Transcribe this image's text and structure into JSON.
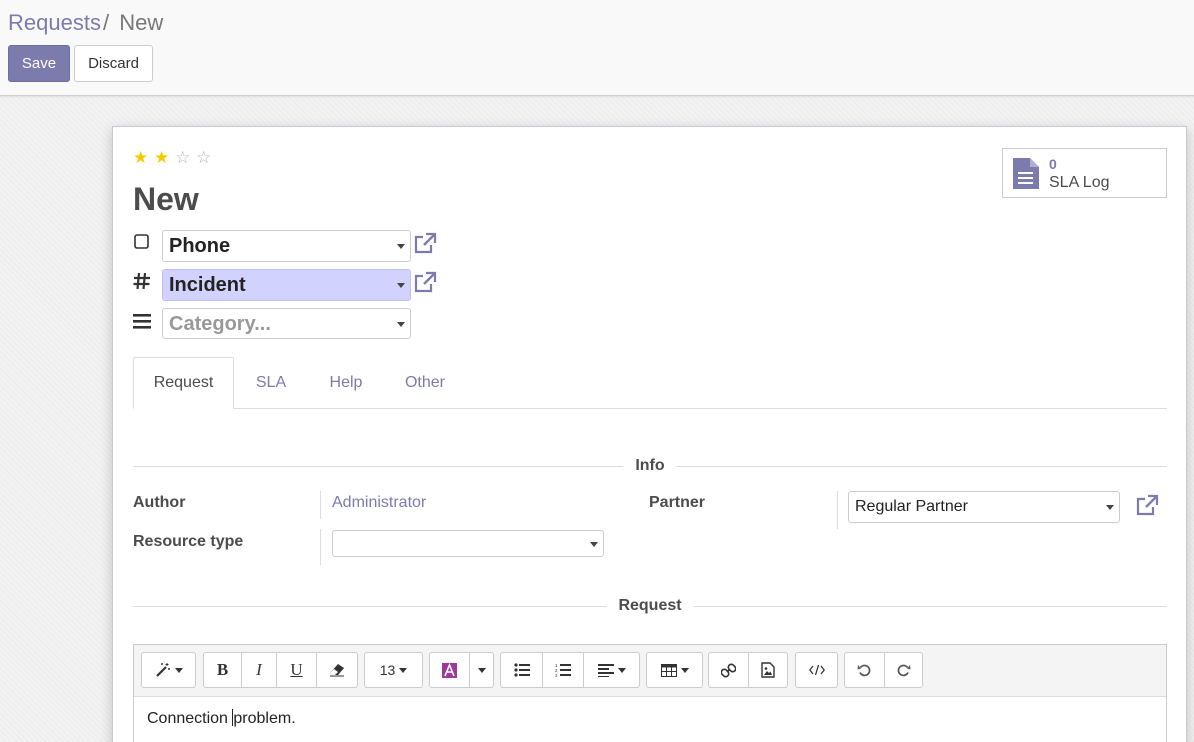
{
  "breadcrumb": {
    "parent": "Requests",
    "separator": "/",
    "current": "New"
  },
  "buttons": {
    "save": "Save",
    "discard": "Discard"
  },
  "rating": {
    "value": 2,
    "max": 5,
    "star_color": "#f3cc00"
  },
  "stat_button": {
    "value": "0",
    "label": "SLA Log",
    "icon": "document-icon"
  },
  "record": {
    "title": "New",
    "channel": {
      "value": "Phone",
      "icon": "square-icon"
    },
    "type": {
      "value": "Incident",
      "icon": "hash-icon"
    },
    "category": {
      "placeholder": "Category...",
      "icon": "list-icon"
    }
  },
  "tabs": [
    "Request",
    "SLA",
    "Help",
    "Other"
  ],
  "info": {
    "section_title": "Info",
    "author_label": "Author",
    "author_value": "Administrator",
    "partner_label": "Partner",
    "partner_value": "Regular Partner",
    "resource_type_label": "Resource type",
    "resource_type_value": ""
  },
  "request": {
    "section_title": "Request",
    "font_size": "13",
    "content_before_cursor": "Connection ",
    "content_after_cursor": "problem."
  },
  "colors": {
    "accent": "#7c7bad",
    "highlight": "#d2d2ff"
  }
}
